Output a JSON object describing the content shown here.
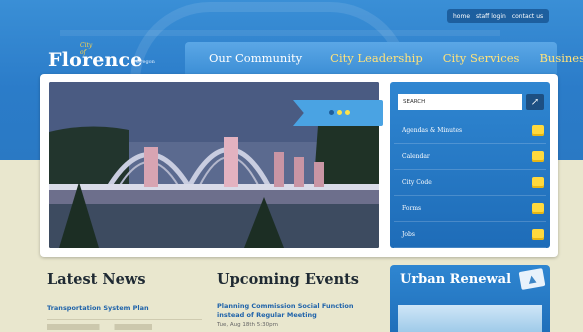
{
  "utility_links": [
    "home",
    "staff login",
    "contact us"
  ],
  "logo": {
    "city_of": "City of",
    "name": "Florence",
    "state": "Oregon"
  },
  "nav": [
    {
      "label": "Our Community"
    },
    {
      "label": "City Leadership"
    },
    {
      "label": "City Services"
    },
    {
      "label": "Business"
    }
  ],
  "search": {
    "placeholder": "SEARCH",
    "button_icon": "arrow-icon"
  },
  "sidebar_links": [
    {
      "label": "Agendas & Minutes",
      "icon": "document-icon"
    },
    {
      "label": "Calendar",
      "icon": "calendar-icon"
    },
    {
      "label": "City Code",
      "icon": "book-icon"
    },
    {
      "label": "Forms",
      "icon": "form-icon"
    },
    {
      "label": "Jobs",
      "icon": "briefcase-icon"
    }
  ],
  "latest_news": {
    "title": "Latest News",
    "items": [
      "Transportation System Plan"
    ]
  },
  "upcoming_events": {
    "title": "Upcoming Events",
    "items": [
      {
        "title": "Planning Commission Social Function instead of Regular Meeting",
        "date": "Tue, Aug 18th 5:30pm"
      }
    ]
  },
  "urban_renewal": {
    "title": "Urban Renewal"
  },
  "colors": {
    "header_blue": "#2b7cc9",
    "nav_blue": "#4a9be0",
    "accent_gold": "#ffd93d",
    "link_blue": "#1f63aa",
    "cream": "#e9e7ce"
  }
}
